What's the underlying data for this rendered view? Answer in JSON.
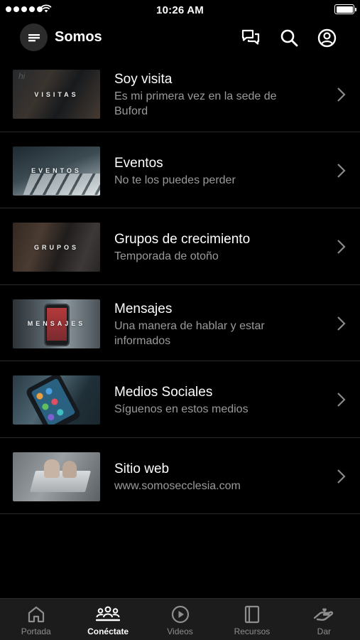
{
  "status_bar": {
    "time": "10:26 AM"
  },
  "header": {
    "title": "Somos",
    "icons": [
      "chat-icon",
      "search-icon",
      "account-icon"
    ]
  },
  "list": [
    {
      "thumb_label": "VISITAS",
      "title": "Soy visita",
      "subtitle": "Es mi primera vez en la sede de Buford"
    },
    {
      "thumb_label": "EVENTOS",
      "title": "Eventos",
      "subtitle": "No te los puedes perder"
    },
    {
      "thumb_label": "GRUPOS",
      "title": "Grupos de crecimiento",
      "subtitle": "Temporada de otoño"
    },
    {
      "thumb_label": "MENSAJES",
      "title": "Mensajes",
      "subtitle": "Una manera de hablar y estar informados"
    },
    {
      "thumb_label": "",
      "title": "Medios Sociales",
      "subtitle": "Síguenos en estos medios"
    },
    {
      "thumb_label": "",
      "title": "Sitio web",
      "subtitle": "www.somosecclesia.com"
    }
  ],
  "tabbar": {
    "active": "Conéctate",
    "tabs": [
      {
        "label": "Portada",
        "icon": "home-icon"
      },
      {
        "label": "Conéctate",
        "icon": "people-icon"
      },
      {
        "label": "Videos",
        "icon": "play-icon"
      },
      {
        "label": "Recursos",
        "icon": "book-icon"
      },
      {
        "label": "Dar",
        "icon": "give-hand-icon"
      }
    ]
  },
  "colors": {
    "background": "#000000",
    "tabbar": "#1c1c1c",
    "subtitle": "#9a9a9a",
    "divider": "#2a2a2a"
  }
}
